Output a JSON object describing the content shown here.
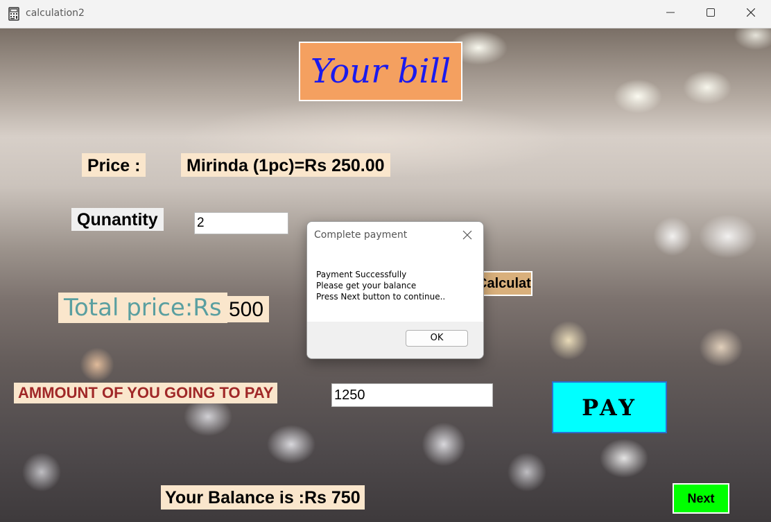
{
  "window": {
    "title": "calculation2",
    "app_icon": "calculator-icon",
    "controls": {
      "minimize": "minimize-icon",
      "maximize": "maximize-icon",
      "close": "close-icon"
    }
  },
  "form": {
    "header_title": "Your bill",
    "price_label": "Price :",
    "price_value": "Mirinda (1pc)=Rs 250.00",
    "quantity_label": "Qunantity",
    "quantity_value": "2",
    "calculate_button_label": "Calculate",
    "total_label": "Total price:Rs",
    "total_value": "500",
    "amount_label": "AMMOUNT OF YOU GOING TO PAY",
    "amount_value": "1250",
    "pay_button_label": "PAY",
    "balance_label": "Your Balance is :Rs 750",
    "next_button_label": "Next"
  },
  "dialog": {
    "title": "Complete payment",
    "message_lines": [
      "Payment Successfully",
      "Please get your balance",
      "Press Next button to continue.."
    ],
    "ok_label": "OK"
  },
  "colors": {
    "header_bg": "#f4a060",
    "header_text": "#1a1aee",
    "label_bg": "#fae6cc",
    "total_label_text": "#5a9fa0",
    "amount_label_text": "#a02828",
    "pay_bg": "#00ffff",
    "next_bg": "#00ff00",
    "calculate_bg": "#d9b07c"
  }
}
